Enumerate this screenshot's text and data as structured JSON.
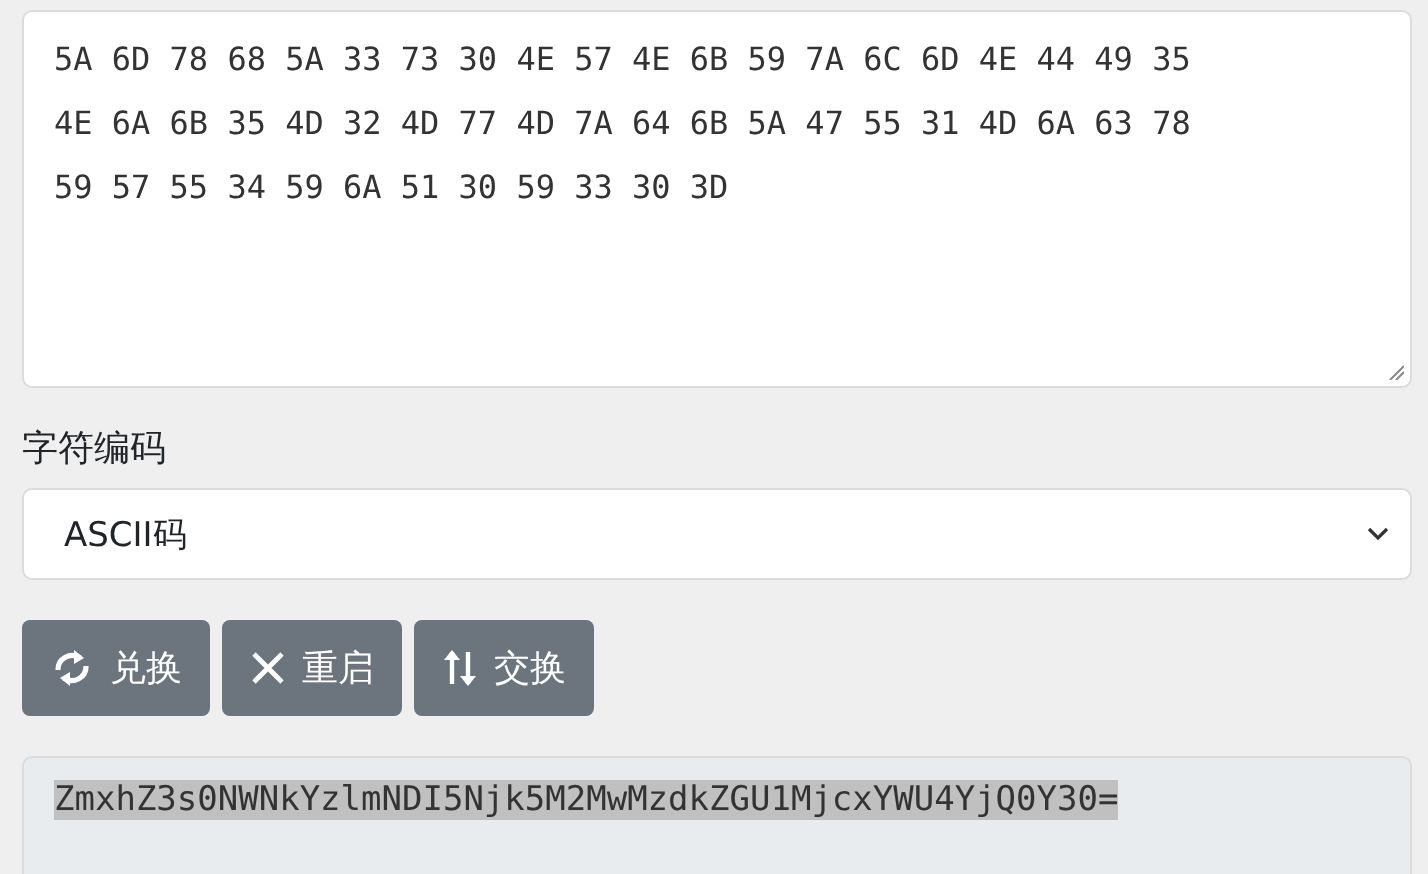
{
  "input": {
    "value": "5A 6D 78 68 5A 33 73 30 4E 57 4E 6B 59 7A 6C 6D 4E 44 49 35 4E 6A 6B 35 4D 32 4D 77 4D 7A 64 6B 5A 47 55 31 4D 6A 63 78 59 57 55 34 59 6A 51 30 59 33 30 3D"
  },
  "encoding": {
    "label": "字符编码",
    "value": "ASCII码"
  },
  "buttons": [
    {
      "kind": "convert",
      "label": "兑换"
    },
    {
      "kind": "reset",
      "label": "重启"
    },
    {
      "kind": "swap",
      "label": "交换"
    }
  ],
  "output": {
    "value": "ZmxhZ3s0NWNkYzlmNDI5Njk5M2MwMzdkZGU1MjcxYWU4YjQ0Y30=",
    "selected": true
  }
}
